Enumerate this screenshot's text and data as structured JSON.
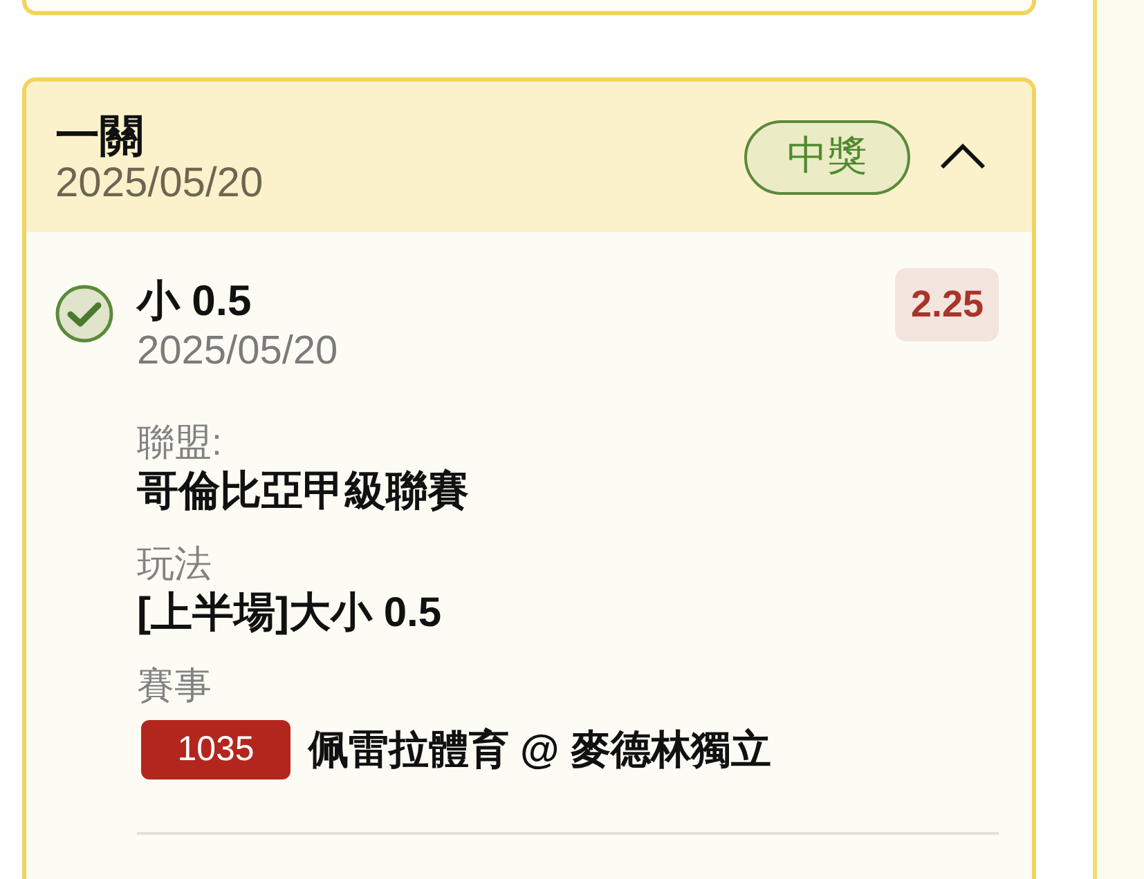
{
  "bet_card": {
    "title": "一關",
    "date": "2025/05/20",
    "status": {
      "label": "中獎",
      "kind": "won"
    },
    "expanded": true,
    "selections": [
      {
        "title": "小 0.5",
        "date": "2025/05/20",
        "won": true,
        "odds": "2.25",
        "details": [
          {
            "kind": "text",
            "label": "聯盟:",
            "value": "哥倫比亞甲級聯賽"
          },
          {
            "kind": "text",
            "label": "玩法",
            "value": "[上半場]大小 0.5"
          },
          {
            "kind": "match",
            "label": "賽事",
            "match_number": "1035",
            "value": "佩雷拉體育 @ 麥德林獨立"
          }
        ]
      }
    ]
  }
}
